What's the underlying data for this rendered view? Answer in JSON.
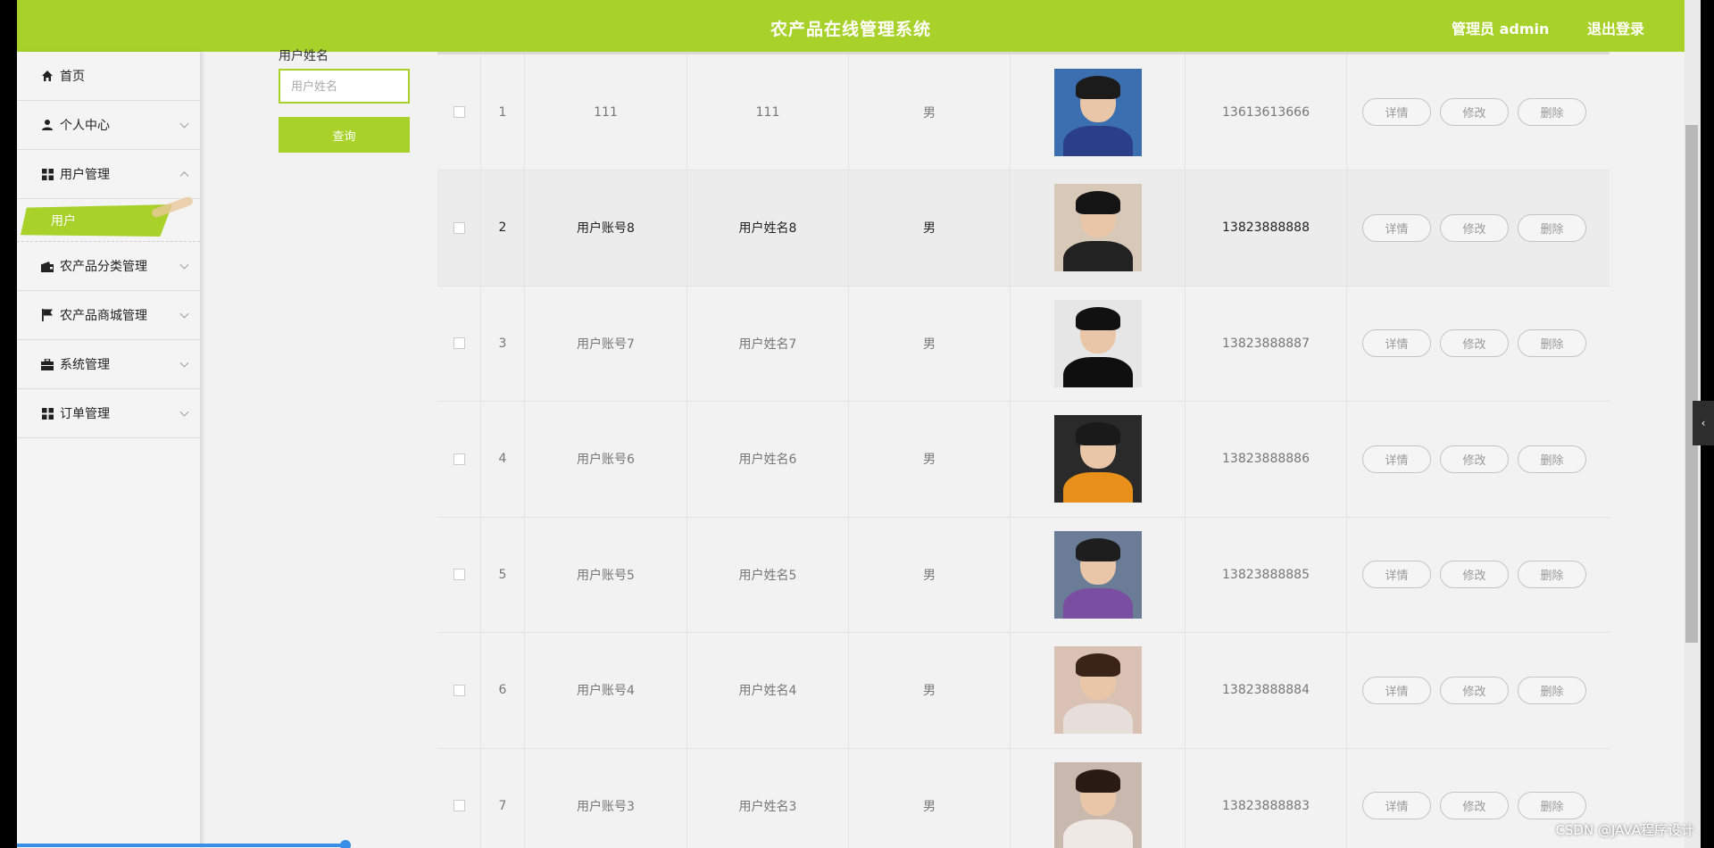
{
  "header": {
    "title": "农产品在线管理系统",
    "user": "管理员 admin",
    "logout": "退出登录",
    "color": "#a8d12a"
  },
  "sidebar": {
    "items": [
      {
        "label": "首页",
        "icon": "home-icon",
        "chevron": false
      },
      {
        "label": "个人中心",
        "icon": "user-icon",
        "chevron": "down"
      },
      {
        "label": "用户管理",
        "icon": "grid-icon",
        "chevron": "up"
      },
      {
        "label": "农产品分类管理",
        "icon": "wallet-icon",
        "chevron": "down"
      },
      {
        "label": "农产品商城管理",
        "icon": "flag-icon",
        "chevron": "down"
      },
      {
        "label": "系统管理",
        "icon": "briefcase-icon",
        "chevron": "down"
      },
      {
        "label": "订单管理",
        "icon": "grid-icon",
        "chevron": "down"
      }
    ],
    "active_sub": "用户"
  },
  "search": {
    "label": "用户姓名",
    "placeholder": "用户姓名",
    "button": "查询"
  },
  "table": {
    "actions": {
      "detail": "详情",
      "edit": "修改",
      "delete": "删除"
    },
    "rows": [
      {
        "index": "1",
        "account": "111",
        "name": "111",
        "gender": "男",
        "phone": "13613613666",
        "avatar": {
          "bg": "#3c6fb0",
          "hair": "#1b1b1b",
          "body": "#2b3f88"
        }
      },
      {
        "index": "2",
        "account": "用户账号8",
        "name": "用户姓名8",
        "gender": "男",
        "phone": "13823888888",
        "avatar": {
          "bg": "#d8c8b8",
          "hair": "#141414",
          "body": "#222222"
        },
        "highlight": true
      },
      {
        "index": "3",
        "account": "用户账号7",
        "name": "用户姓名7",
        "gender": "男",
        "phone": "13823888887",
        "avatar": {
          "bg": "#e6e6e6",
          "hair": "#111111",
          "body": "#0f0f0f"
        }
      },
      {
        "index": "4",
        "account": "用户账号6",
        "name": "用户姓名6",
        "gender": "男",
        "phone": "13823888886",
        "avatar": {
          "bg": "#2a2a2a",
          "hair": "#1a1a1a",
          "body": "#e8901a"
        }
      },
      {
        "index": "5",
        "account": "用户账号5",
        "name": "用户姓名5",
        "gender": "男",
        "phone": "13823888885",
        "avatar": {
          "bg": "#6a7c96",
          "hair": "#1e1e1e",
          "body": "#7a4ea0"
        }
      },
      {
        "index": "6",
        "account": "用户账号4",
        "name": "用户姓名4",
        "gender": "男",
        "phone": "13823888884",
        "avatar": {
          "bg": "#d9c2b4",
          "hair": "#3a2418",
          "body": "#e6dedb"
        }
      },
      {
        "index": "7",
        "account": "用户账号3",
        "name": "用户姓名3",
        "gender": "男",
        "phone": "13823888883",
        "avatar": {
          "bg": "#c9b8ad",
          "hair": "#2a1a14",
          "body": "#efe9e6"
        }
      }
    ]
  },
  "side_tab": {
    "icon": "chevron-left-icon",
    "glyph": "‹"
  },
  "watermark": "CSDN @JAVA程序设计"
}
